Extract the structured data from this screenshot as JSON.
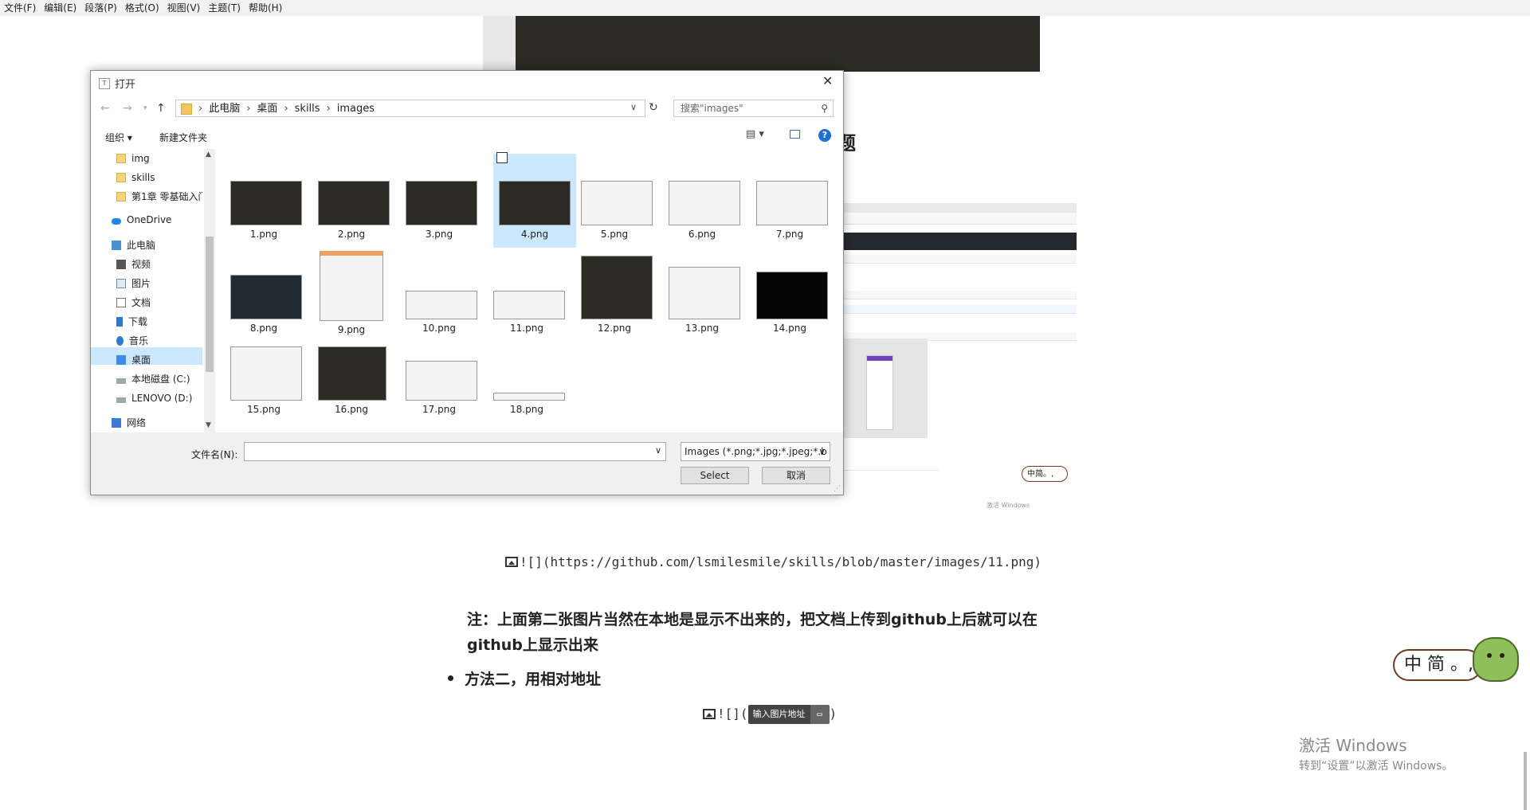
{
  "menu": [
    "文件(F)",
    "编辑(E)",
    "段落(P)",
    "格式(O)",
    "视图(V)",
    "主题(T)",
    "帮助(H)"
  ],
  "editor": {
    "heading_tail": "题",
    "image_link_1": "![](https://github.com/lsmilesmile/skills/blob/master/images/11.png)",
    "note": "注：上面第二张图片当然在本地是显示不出来的，把文档上传到github上后就可以在github上显示出来",
    "bullet": "方法二，用相对地址",
    "image_link_2_prefix": "![](",
    "image_link_2_suffix": ")",
    "tooltip": "输入图片地址",
    "ime_text": "中 简 。,",
    "preview_ime": "中简。,",
    "preview_activate": "激活 Windows"
  },
  "activate": {
    "line1": "激活 Windows",
    "line2": "转到“设置”以激活 Windows。"
  },
  "dialog": {
    "title": "打开",
    "breadcrumbs": [
      "此电脑",
      "桌面",
      "skills",
      "images"
    ],
    "search_placeholder": "搜索\"images\"",
    "organize": "组织 ▾",
    "new_folder": "新建文件夹",
    "help": "?",
    "sidebar": [
      {
        "label": "img",
        "icon": "folder-icon"
      },
      {
        "label": "skills",
        "icon": "folder-icon"
      },
      {
        "label": "第1章 零基础入门",
        "icon": "folder-icon"
      },
      {
        "label": "OneDrive",
        "icon": "cloud-icon"
      },
      {
        "label": "此电脑",
        "icon": "pc-icon"
      },
      {
        "label": "视频",
        "icon": "video-icon"
      },
      {
        "label": "图片",
        "icon": "picture-icon"
      },
      {
        "label": "文档",
        "icon": "document-icon"
      },
      {
        "label": "下载",
        "icon": "download-icon"
      },
      {
        "label": "音乐",
        "icon": "music-icon"
      },
      {
        "label": "桌面",
        "icon": "desktop-icon"
      },
      {
        "label": "本地磁盘 (C:)",
        "icon": "disk-icon"
      },
      {
        "label": "LENOVO (D:)",
        "icon": "disk-icon"
      },
      {
        "label": "网络",
        "icon": "network-icon"
      }
    ],
    "files": [
      "1.png",
      "2.png",
      "3.png",
      "4.png",
      "5.png",
      "6.png",
      "7.png",
      "8.png",
      "9.png",
      "10.png",
      "11.png",
      "12.png",
      "13.png",
      "14.png",
      "15.png",
      "16.png",
      "17.png",
      "18.png"
    ],
    "selected_file": "4.png",
    "filename_label": "文件名(N):",
    "filename_value": "",
    "filetype": "Images (*.png;*.jpg;*.jpeg;*.b",
    "select_button": "Select",
    "cancel_button": "取消"
  },
  "colors": {
    "selection": "#cce8ff",
    "help_blue": "#1d6fd1",
    "editor_dark": "#2b2b24"
  }
}
